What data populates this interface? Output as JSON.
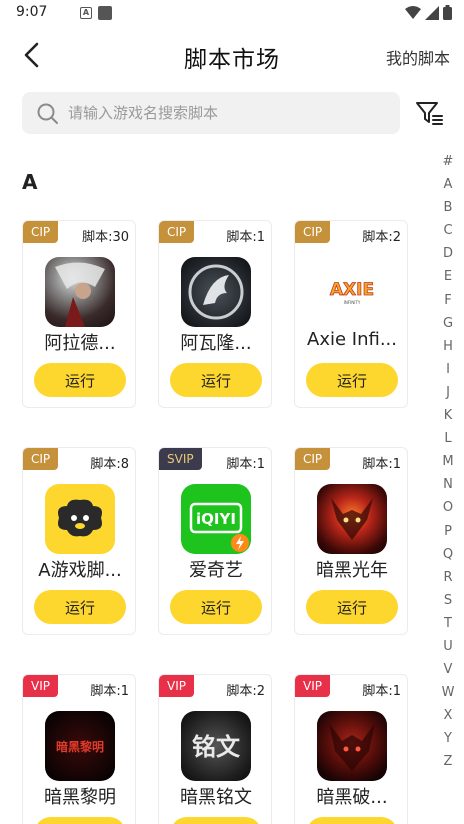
{
  "status_bar": {
    "time": "9:07"
  },
  "header": {
    "title": "脚本市场",
    "my_scripts": "我的脚本"
  },
  "search": {
    "placeholder": "请输入游戏名搜索脚本"
  },
  "section": {
    "letter": "A"
  },
  "run_label": "运行",
  "cards": [
    {
      "badge": "CIP",
      "badge_type": "cip",
      "count": "脚本:30",
      "name": "阿拉德...",
      "icon": "arad-warrior-icon"
    },
    {
      "badge": "CIP",
      "badge_type": "cip",
      "count": "脚本:1",
      "name": "阿瓦隆...",
      "icon": "avalon-dragon-icon"
    },
    {
      "badge": "CIP",
      "badge_type": "cip",
      "count": "脚本:2",
      "name": "Axie Infi...",
      "icon": "axie-logo-icon",
      "icon_text": "AXIE"
    },
    {
      "badge": "CIP",
      "badge_type": "cip",
      "count": "脚本:8",
      "name": "A游戏脚...",
      "icon": "sheep-icon"
    },
    {
      "badge": "SVIP",
      "badge_type": "svip",
      "count": "脚本:1",
      "name": "爱奇艺",
      "icon": "iqiyi-icon",
      "icon_text": "iQIYI"
    },
    {
      "badge": "CIP",
      "badge_type": "cip",
      "count": "脚本:1",
      "name": "暗黑光年",
      "icon": "demon-icon"
    },
    {
      "badge": "VIP",
      "badge_type": "vip",
      "count": "脚本:1",
      "name": "暗黑黎明",
      "icon": "dark-dawn-icon",
      "icon_text": "暗黑黎明"
    },
    {
      "badge": "VIP",
      "badge_type": "vip",
      "count": "脚本:2",
      "name": "暗黑铭文",
      "icon": "inscription-icon",
      "icon_text": "铭文"
    },
    {
      "badge": "VIP",
      "badge_type": "vip",
      "count": "脚本:1",
      "name": "暗黑破...",
      "icon": "demon-icon-2"
    }
  ],
  "alphabet": [
    "#",
    "A",
    "B",
    "C",
    "D",
    "E",
    "F",
    "G",
    "H",
    "I",
    "J",
    "K",
    "L",
    "M",
    "N",
    "O",
    "P",
    "Q",
    "R",
    "S",
    "T",
    "U",
    "V",
    "W",
    "X",
    "Y",
    "Z"
  ],
  "colors": {
    "accent": "#fdd72e",
    "cip": "#c5913a",
    "svip": "#3b3b4d",
    "vip": "#e83048"
  }
}
